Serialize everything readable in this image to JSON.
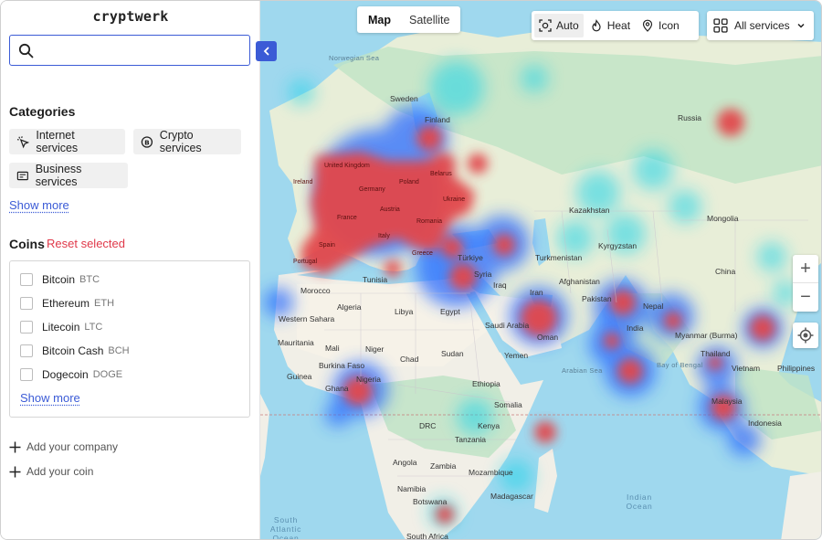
{
  "app": {
    "logo": "cryptwerk"
  },
  "search": {
    "value": "",
    "placeholder": ""
  },
  "categories": {
    "title": "Categories",
    "items": [
      {
        "label": "Internet services",
        "icon": "cursor-click-icon"
      },
      {
        "label": "Crypto services",
        "icon": "bitcoin-coin-icon"
      },
      {
        "label": "Business services",
        "icon": "cash-register-icon"
      }
    ],
    "show_more": "Show more"
  },
  "coins": {
    "title": "Coins",
    "reset": "Reset selected",
    "items": [
      {
        "name": "Bitcoin",
        "ticker": "BTC",
        "checked": false
      },
      {
        "name": "Ethereum",
        "ticker": "ETH",
        "checked": false
      },
      {
        "name": "Litecoin",
        "ticker": "LTC",
        "checked": false
      },
      {
        "name": "Bitcoin Cash",
        "ticker": "BCH",
        "checked": false
      },
      {
        "name": "Dogecoin",
        "ticker": "DOGE",
        "checked": false
      }
    ],
    "show_more": "Show more"
  },
  "actions": {
    "add_company": "Add your company",
    "add_coin": "Add your coin"
  },
  "map": {
    "view_toggle": {
      "options": [
        "Map",
        "Satellite"
      ],
      "selected": "Map"
    },
    "modes": {
      "options": [
        "Auto",
        "Heat",
        "Icon"
      ],
      "selected": "Auto"
    },
    "services_filter": "All services",
    "zoom_in": "+",
    "zoom_out": "−",
    "colors": {
      "water": "#9fd8ee",
      "land": "#f1efe7",
      "vegetation": "#bfe3c5",
      "heat_hot": "#e2474b",
      "heat_cold": "#1e6bff",
      "accent": "#3b5bd6"
    },
    "places": {
      "norwegian_sea": "Norwegian Sea",
      "sweden": "Sweden",
      "finland": "Finland",
      "russia": "Russia",
      "united_kingdom": "United Kingdom",
      "ireland": "Ireland",
      "germany": "Germany",
      "poland": "Poland",
      "belarus": "Belarus",
      "ukraine": "Ukraine",
      "france": "France",
      "austria": "Austria",
      "romania": "Romania",
      "spain": "Spain",
      "italy": "Italy",
      "portugal": "Portugal",
      "greece": "Greece",
      "turkiye": "Türkiye",
      "kazakhstan": "Kazakhstan",
      "mongolia": "Mongolia",
      "kyrgyzstan": "Kyrgyzstan",
      "turkmenistan": "Turkmenistan",
      "syria": "Syria",
      "iraq": "Iraq",
      "iran": "Iran",
      "afghanistan": "Afghanistan",
      "china": "China",
      "tunisia": "Tunisia",
      "morocco": "Morocco",
      "algeria": "Algeria",
      "libya": "Libya",
      "egypt": "Egypt",
      "pakistan": "Pakistan",
      "nepal": "Nepal",
      "saudi_arabia": "Saudi Arabia",
      "oman": "Oman",
      "india": "India",
      "myanmar": "Myanmar (Burma)",
      "western_sahara": "Western Sahara",
      "mauritania": "Mauritania",
      "mali": "Mali",
      "niger": "Niger",
      "chad": "Chad",
      "sudan": "Sudan",
      "yemen": "Yemen",
      "thailand": "Thailand",
      "burkina_faso": "Burkina Faso",
      "guinea": "Guinea",
      "nigeria": "Nigeria",
      "ghana": "Ghana",
      "ethiopia": "Ethiopia",
      "somalia": "Somalia",
      "bay_of_bengal": "Bay of Bengal",
      "arabian_sea": "Arabian Sea",
      "vietnam": "Vietnam",
      "philippines": "Philippines",
      "malaysia": "Malaysia",
      "indonesia": "Indonesia",
      "drc": "DRC",
      "kenya": "Kenya",
      "tanzania": "Tanzania",
      "angola": "Angola",
      "zambia": "Zambia",
      "mozambique": "Mozambique",
      "namibia": "Namibia",
      "botswana": "Botswana",
      "madagascar": "Madagascar",
      "south_africa": "South Africa",
      "south_atlantic_ocean": "South Atlantic Ocean",
      "indian_ocean": "Indian Ocean"
    }
  }
}
